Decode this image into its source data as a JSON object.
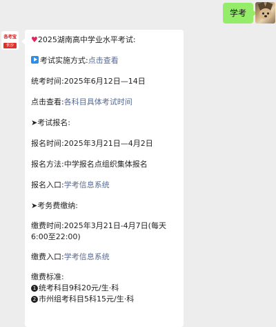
{
  "user": {
    "message": "学考"
  },
  "bot": {
    "avatar_brand": "各考宝",
    "avatar_city": "长沙",
    "title": "2025湖南高中学业水平考试:",
    "mode_label": "考试实施方式:",
    "mode_link": "点击查看",
    "unified_time_label": "统考时间:",
    "unified_time_value": "2025年6月12日—14日",
    "click_label": "点击查看:",
    "click_link": "各科目具体考试时间",
    "signup_heading": "考试报名:",
    "signup_time_label": "报名时间:",
    "signup_time_value": "2025年3月21日—4月2日",
    "signup_method_label": "报名方法:",
    "signup_method_value": "中学报名点组织集体报名",
    "signup_entry_label": "报名入口:",
    "signup_entry_link": "学考信息系统",
    "fee_heading": "考务费缴纳:",
    "fee_time_label": "缴费时间:",
    "fee_time_value": "2025年3月21日-4月7日(每天6:00至22:00)",
    "fee_entry_label": "缴费入口:",
    "fee_entry_link": "学考信息系统",
    "fee_standard_label": "缴费标准:",
    "fee_item1": "统考科目9科20元/生·科",
    "fee_item2": "市州组考科目5科15元/生·科",
    "num1": "1",
    "num2": "2"
  }
}
